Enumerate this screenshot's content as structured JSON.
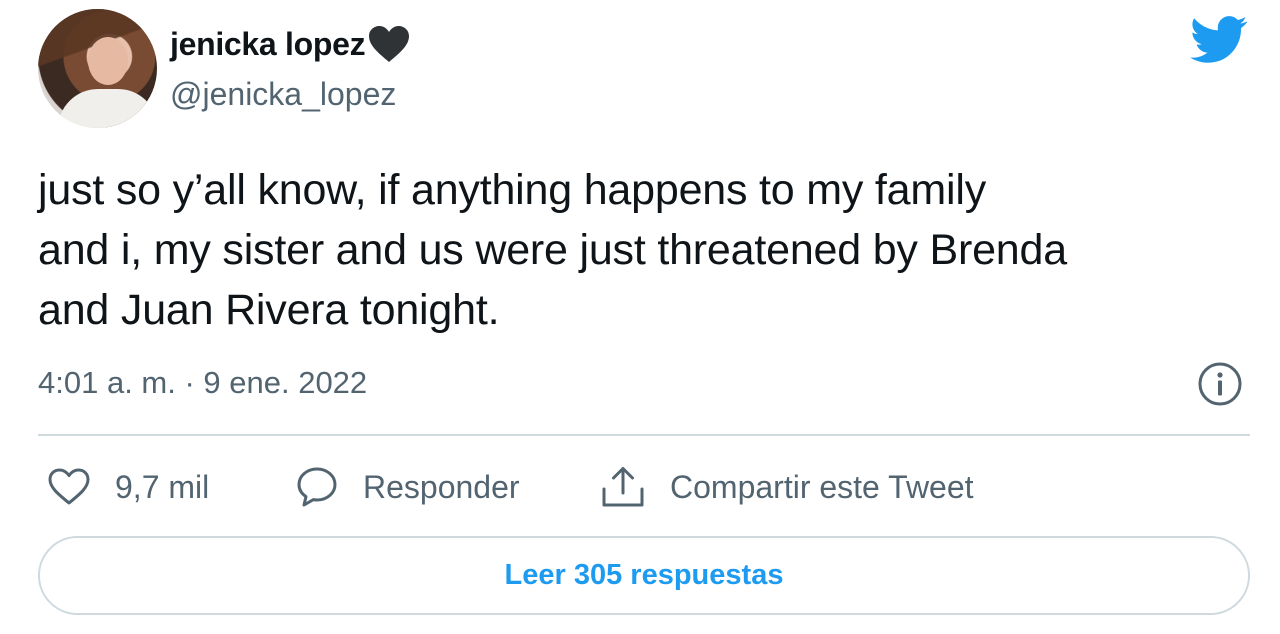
{
  "author": {
    "display_name": "jenicka lopez",
    "handle": "@jenicka_lopez",
    "avatar_icon": "profile-photo"
  },
  "brand": {
    "logo_icon": "twitter-bird-icon",
    "accent_color": "#1d9bf0"
  },
  "tweet": {
    "lines": [
      "just so y’all know, if anything happens to my family",
      "and i, my sister and us were just threatened by Brenda",
      "and Juan Rivera tonight."
    ],
    "timestamp": "4:01 a. m. · 9 ene. 2022"
  },
  "actions": {
    "likes_count": "9,7 mil",
    "reply_label": "Responder",
    "share_label": "Compartir este Tweet"
  },
  "read_replies_label": "Leer 305 respuestas"
}
